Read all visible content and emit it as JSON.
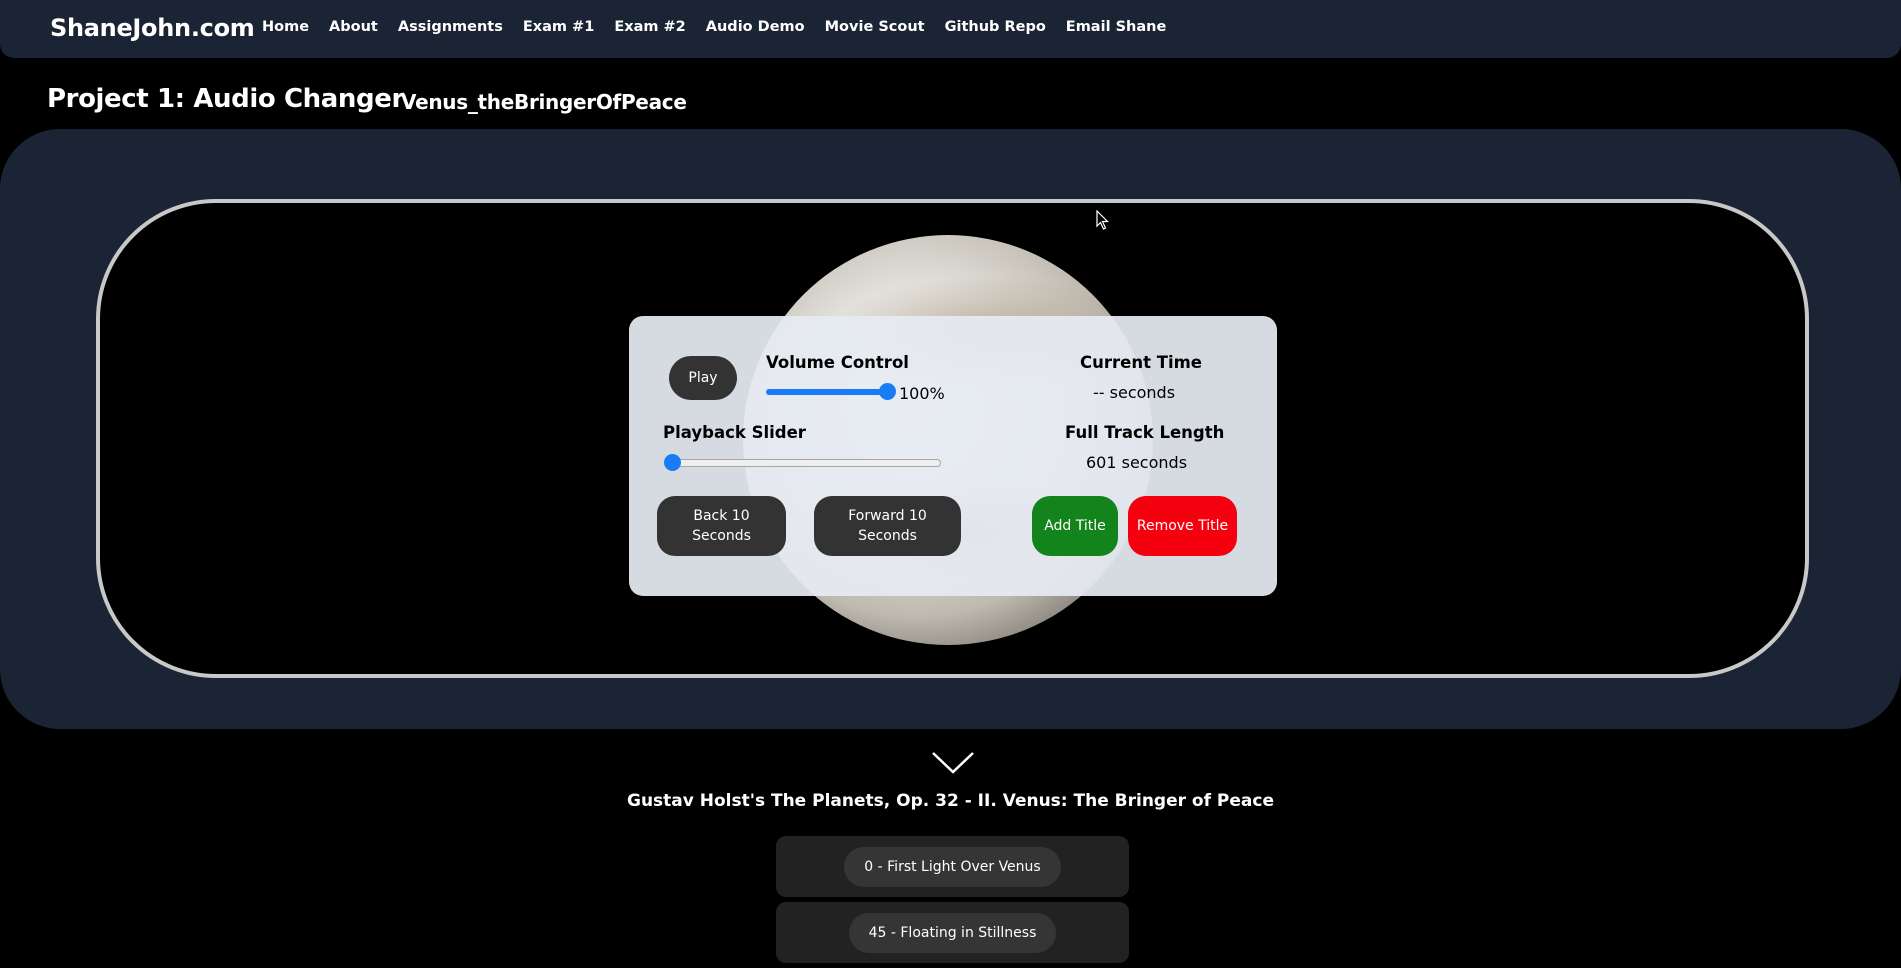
{
  "nav": {
    "brand": "ShaneJohn.com",
    "links": [
      {
        "label": "Home"
      },
      {
        "label": "About"
      },
      {
        "label": "Assignments"
      },
      {
        "label": "Exam #1"
      },
      {
        "label": "Exam #2"
      },
      {
        "label": "Audio Demo"
      },
      {
        "label": "Movie Scout"
      },
      {
        "label": "Github Repo"
      },
      {
        "label": "Email Shane"
      }
    ]
  },
  "header": {
    "title": "Project 1: Audio Changer",
    "track_name": "Venus_theBringerOfPeace"
  },
  "player": {
    "play_label": "Play",
    "volume_label": "Volume Control",
    "volume_value": "100%",
    "volume_level": 1.0,
    "playback_label": "Playback Slider",
    "playback_position": 0,
    "current_time_label": "Current Time",
    "current_time_value": "-- seconds",
    "full_length_label": "Full Track Length",
    "full_length_value": "601 seconds",
    "back_label": "Back 10 Seconds",
    "forward_label": "Forward 10 Seconds",
    "add_title_label": "Add Title",
    "remove_title_label": "Remove Title"
  },
  "piece": {
    "title": "Gustav Holst's The Planets, Op. 32 - II. Venus: The Bringer of Peace",
    "tracks": [
      {
        "label": "0 - First Light Over Venus"
      },
      {
        "label": "45 - Floating in Stillness"
      }
    ]
  },
  "colors": {
    "navbar_bg": "#1b2434",
    "slider_blue": "#1a7cf5",
    "add_green": "#13831c",
    "remove_red": "#f5000f"
  },
  "icons": {
    "chevron": "chevron-down-icon",
    "cursor": "mouse-cursor-icon"
  }
}
